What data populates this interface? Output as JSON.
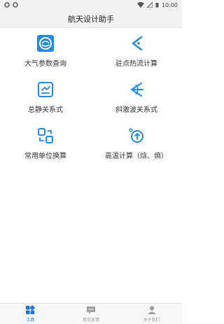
{
  "status_bar": {
    "time": "10:00"
  },
  "header": {
    "title": "航天设计助手"
  },
  "tools": [
    {
      "label": "大气参数查询",
      "icon": "atmosphere-icon"
    },
    {
      "label": "驻点热流计算",
      "icon": "stagnation-heat-icon"
    },
    {
      "label": "总静关系式",
      "icon": "total-static-icon"
    },
    {
      "label": "斜激波关系式",
      "icon": "oblique-shock-icon"
    },
    {
      "label": "常用单位换算",
      "icon": "unit-convert-icon"
    },
    {
      "label": "高温计算（焓、熵）",
      "icon": "high-temp-icon"
    }
  ],
  "tabs": [
    {
      "label": "工具",
      "active": true,
      "icon": "tools-grid-icon"
    },
    {
      "label": "意见反馈",
      "active": false,
      "icon": "feedback-chat-icon"
    },
    {
      "label": "关于我们",
      "active": false,
      "icon": "about-person-icon"
    }
  ],
  "colors": {
    "accent": "#1976d2",
    "icon_blue": "#1e88e5",
    "tab_gray": "#a0a0a0"
  }
}
